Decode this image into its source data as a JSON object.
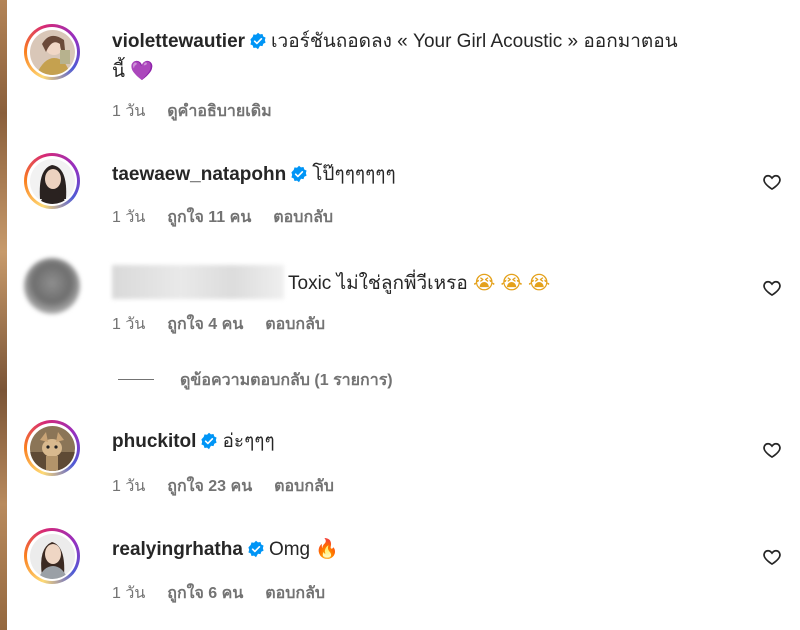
{
  "comments": [
    {
      "username": "violettewautier",
      "verified": true,
      "text": "เวอร์ชันถอดลง « Your Girl Acoustic » ออกมาตอน",
      "text2": "นี้",
      "emoji": "💜",
      "time": "1 วัน",
      "action": "ดูคำอธิบายเดิม"
    },
    {
      "username": "taewaew_natapohn",
      "verified": true,
      "text": "โป๊ๆๆๆๆๆๆ",
      "time": "1 วัน",
      "likes": "ถูกใจ 11 คน",
      "reply": "ตอบกลับ"
    },
    {
      "username": "",
      "verified": false,
      "text": "Toxic ไม่ใช่ลูกพี่วีเหรอ",
      "emoji": "😭 😭 😭",
      "time": "1 วัน",
      "likes": "ถูกใจ 4 คน",
      "reply": "ตอบกลับ"
    },
    {
      "username": "phuckitol",
      "verified": true,
      "text": "อ่ะๆๆๆ",
      "time": "1 วัน",
      "likes": "ถูกใจ 23 คน",
      "reply": "ตอบกลับ"
    },
    {
      "username": "realyingrhatha",
      "verified": true,
      "text": "Omg",
      "emoji": "🔥",
      "time": "1 วัน",
      "likes": "ถูกใจ 6 คน",
      "reply": "ตอบกลับ"
    }
  ],
  "view_replies": "ดูข้อความตอบกลับ (1 รายการ)",
  "icons": {
    "verified": "verified-badge-icon",
    "like": "heart-outline-icon"
  },
  "colors": {
    "text": "#262626",
    "secondary": "#737373",
    "verified": "#0095f6",
    "story_ring": [
      "#feda75",
      "#fa7e1e",
      "#d62976",
      "#962fbf",
      "#4f5bd5"
    ]
  }
}
